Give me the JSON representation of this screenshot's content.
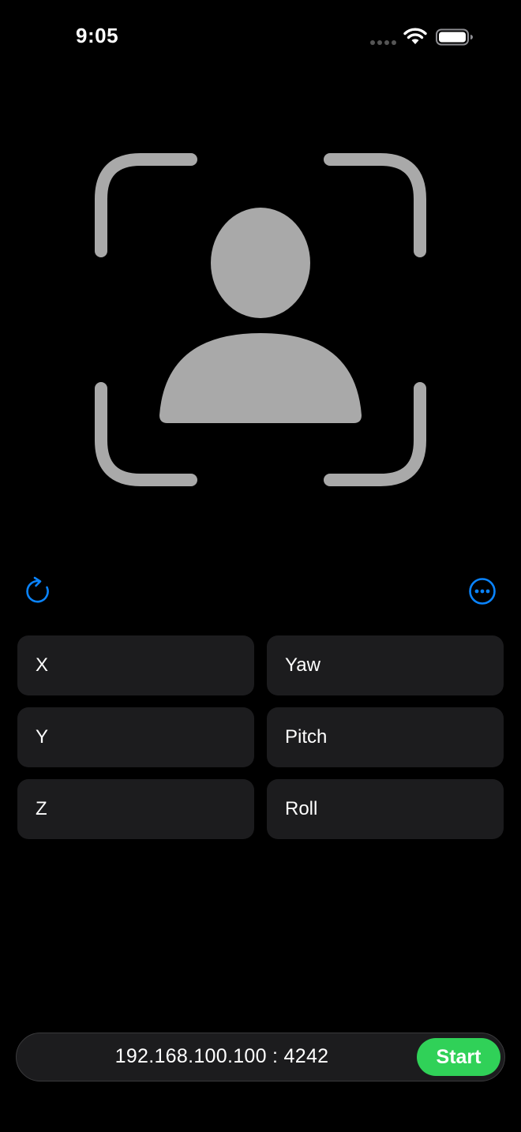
{
  "status_bar": {
    "time": "9:05"
  },
  "colors": {
    "background": "#000000",
    "cell_background": "#1c1c1e",
    "accent_blue": "#0a84ff",
    "start_green": "#30d158",
    "graphic_gray": "#a9a9a9"
  },
  "icons": {
    "face": "face-tracking-icon",
    "refresh": "refresh-icon",
    "more": "more-options-icon"
  },
  "cells": [
    {
      "label": "X"
    },
    {
      "label": "Yaw"
    },
    {
      "label": "Y"
    },
    {
      "label": "Pitch"
    },
    {
      "label": "Z"
    },
    {
      "label": "Roll"
    }
  ],
  "connection": {
    "address": "192.168.100.100 : 4242",
    "start_label": "Start"
  }
}
